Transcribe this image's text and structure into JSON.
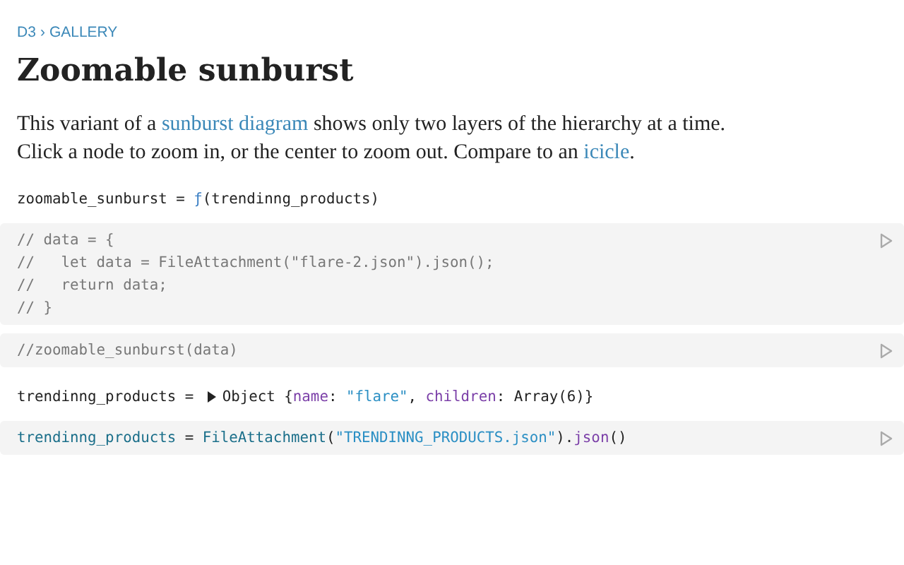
{
  "breadcrumb": {
    "items": [
      "D3",
      "GALLERY"
    ],
    "separator": "›"
  },
  "title": "Zoomable sunburst",
  "description": {
    "lines": [
      [
        {
          "text": "This variant of a ",
          "link": false
        },
        {
          "text": "sunburst diagram",
          "link": true
        },
        {
          "text": " shows only two layers of the hierarchy at a time.",
          "link": false
        }
      ],
      [
        {
          "text": "Click a node to zoom in, or the center to zoom out. Compare to an ",
          "link": false
        },
        {
          "text": "icicle",
          "link": true
        },
        {
          "text": ".",
          "link": false
        }
      ]
    ]
  },
  "cells": [
    {
      "kind": "output",
      "lines": [
        [
          {
            "kind": "plain",
            "text": "zoomable_sunburst = "
          },
          {
            "kind": "function",
            "text": "ƒ"
          },
          {
            "kind": "plain",
            "text": "(trendinng_products)"
          }
        ]
      ]
    },
    {
      "kind": "code",
      "lines": [
        [
          {
            "kind": "comment",
            "text": "// data = {"
          }
        ],
        [
          {
            "kind": "comment",
            "text": "//   let data = FileAttachment(\"flare-2.json\").json();"
          }
        ],
        [
          {
            "kind": "comment",
            "text": "//   return data;"
          }
        ],
        [
          {
            "kind": "comment",
            "text": "// }"
          }
        ]
      ]
    },
    {
      "kind": "code",
      "lines": [
        [
          {
            "kind": "comment",
            "text": "//zoomable_sunburst(data)"
          }
        ]
      ]
    },
    {
      "kind": "output",
      "lines": [
        [
          {
            "kind": "plain",
            "text": "trendinng_products = "
          },
          {
            "kind": "toggle",
            "expanded": false
          },
          {
            "kind": "plain",
            "text": "Object {"
          },
          {
            "kind": "key",
            "text": "name"
          },
          {
            "kind": "plain",
            "text": ": "
          },
          {
            "kind": "string",
            "text": "\"flare\""
          },
          {
            "kind": "plain",
            "text": ", "
          },
          {
            "kind": "key",
            "text": "children"
          },
          {
            "kind": "plain",
            "text": ": Array(6)}"
          }
        ]
      ]
    },
    {
      "kind": "code",
      "lines": [
        [
          {
            "kind": "variable",
            "text": "trendinng_products"
          },
          {
            "kind": "plain",
            "text": " = "
          },
          {
            "kind": "variable",
            "text": "FileAttachment"
          },
          {
            "kind": "plain",
            "text": "("
          },
          {
            "kind": "string",
            "text": "\"TRENDINNG_PRODUCTS.json\""
          },
          {
            "kind": "plain",
            "text": ")."
          },
          {
            "kind": "key",
            "text": "json"
          },
          {
            "kind": "plain",
            "text": "()"
          }
        ]
      ]
    }
  ]
}
